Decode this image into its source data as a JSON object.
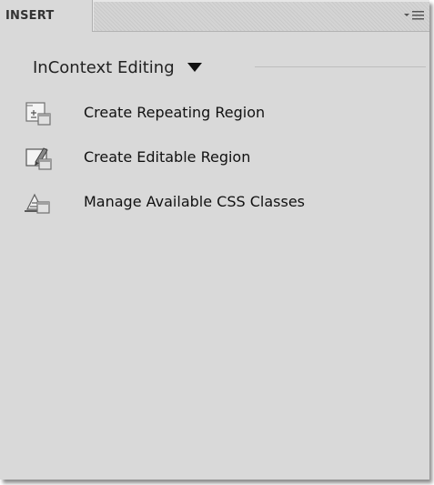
{
  "panel": {
    "tab_label": "INSERT",
    "category_label": "InContext Editing",
    "items": [
      {
        "label": "Create Repeating Region",
        "icon": "repeating-region-icon"
      },
      {
        "label": "Create Editable Region",
        "icon": "editable-region-icon"
      },
      {
        "label": "Manage Available CSS Classes",
        "icon": "css-classes-icon"
      }
    ]
  },
  "colors": {
    "panel_bg": "#d9d9d9",
    "tab_bg": "#d9d9d9",
    "text": "#111111"
  }
}
